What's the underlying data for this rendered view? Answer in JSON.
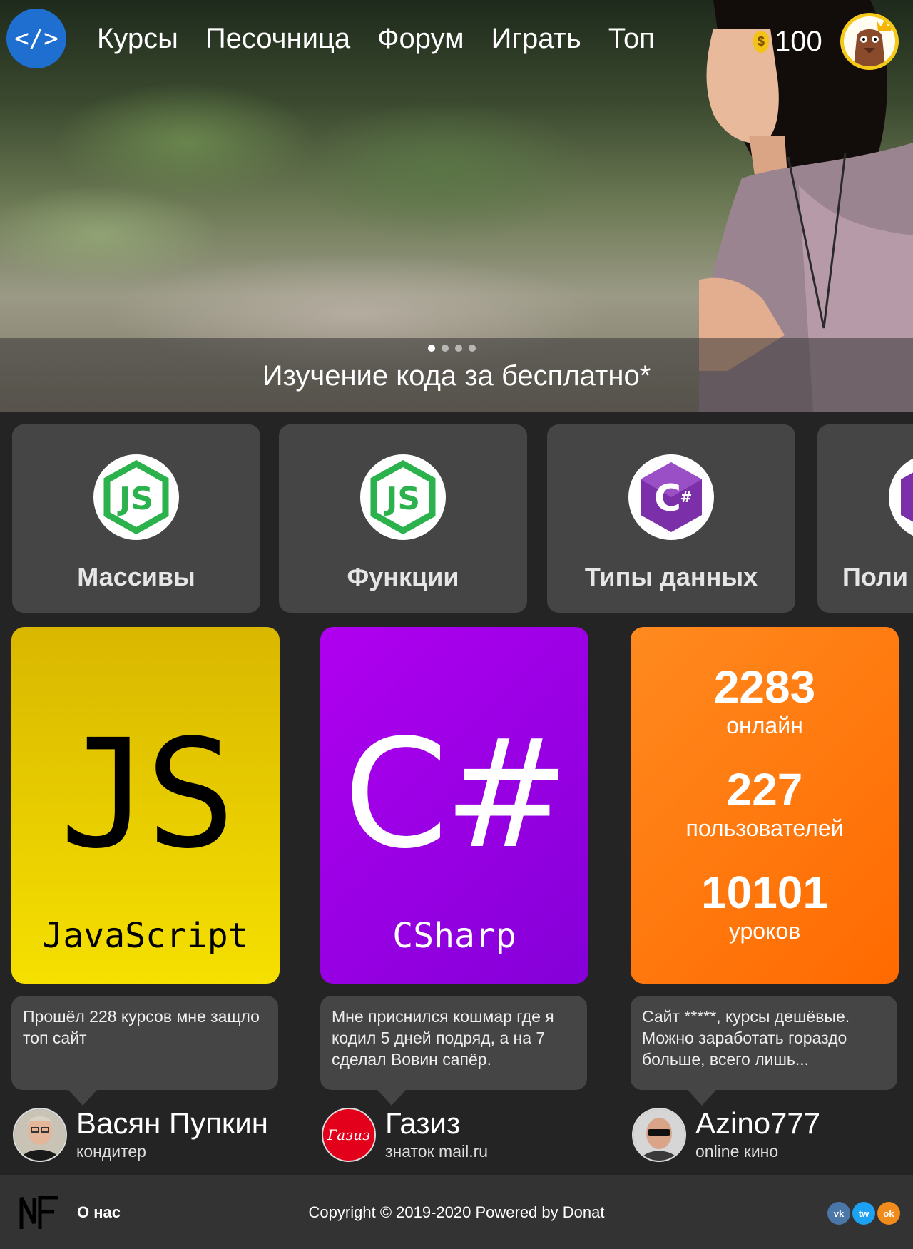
{
  "nav": {
    "logo_symbol": "</>",
    "items": [
      "Курсы",
      "Песочница",
      "Форум",
      "Играть",
      "Топ"
    ],
    "coins": "100",
    "coin_icon": "money-bag-icon"
  },
  "hero": {
    "caption": "Изучение кода за бесплатно*",
    "slides_total": 4,
    "active_slide": 1
  },
  "courses": [
    {
      "title": "Массивы",
      "icon": "nodejs-icon"
    },
    {
      "title": "Функции",
      "icon": "nodejs-icon"
    },
    {
      "title": "Типы данных",
      "icon": "csharp-icon"
    },
    {
      "title": "Поли",
      "icon": "csharp-icon"
    }
  ],
  "tiles": {
    "js": {
      "big": "JS",
      "name": "JavaScript",
      "color": "#f2d900"
    },
    "cs": {
      "big": "C#",
      "name": "CSharp",
      "color": "#a000e6"
    },
    "stats": {
      "color": "#ff7a10",
      "online": "2283",
      "online_label": "онлайн",
      "users": "227",
      "users_label": "пользователей",
      "lessons": "10101",
      "lessons_label": "уроков"
    }
  },
  "reviews": [
    {
      "text": "Прошёл 228 курсов мне защло топ сайт",
      "name": "Васян Пупкин",
      "role": "кондитер"
    },
    {
      "text": "Мне приснился кошмар где я кодил 5 дней подряд, а на 7 сделал Вовин сапёр.",
      "name": "Газиз",
      "role": "знаток mail.ru",
      "avatar_text": "Газиз"
    },
    {
      "text": "Сайт *****, курсы дешёвые. Можно заработать гораздо больше, всего лишь...",
      "name": "Azino777",
      "role": "online кино"
    }
  ],
  "footer": {
    "logo": "NF",
    "about": "О нас",
    "copyright": "Copyright © 2019-2020 Powered by Donat",
    "social": [
      {
        "label": "vk",
        "icon": "vk-icon"
      },
      {
        "label": "tw",
        "icon": "twitter-icon"
      },
      {
        "label": "ok",
        "icon": "odnoklassniki-icon"
      }
    ]
  }
}
